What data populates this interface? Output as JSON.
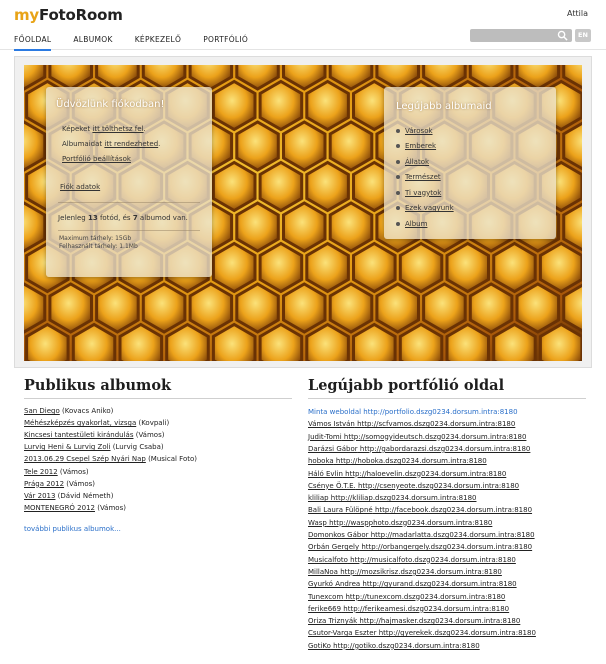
{
  "header": {
    "logo_my": "my",
    "logo_rest": "FotoRoom",
    "username": "Attila",
    "lang": "EN",
    "nav": [
      "FŐOLDAL",
      "ALBUMOK",
      "KÉPKEZELŐ",
      "PORTFÓLIÓ"
    ],
    "active_nav": "FŐOLDAL"
  },
  "welcome": {
    "title": "Üdvözlünk fiókodban!",
    "line1_pre": "Képeket ",
    "line1_link": "itt tölthetsz fel",
    "line1_post": ".",
    "line2_pre": "Albumaidat ",
    "line2_link": "itt rendezheted",
    "line2_post": ".",
    "line3_link": "Portfólió beállítások",
    "account_link": "Fiók adatok",
    "stats_pre": "Jelenleg ",
    "stats_photos": "13",
    "stats_mid": " fotód, és ",
    "stats_albums": "7",
    "stats_post": " albumod van.",
    "max_storage": "Maximum tárhely: 15Gb",
    "used_storage": "Felhasznált tárhely: 1.1Mb"
  },
  "latest_albums": {
    "title": "Legújabb albumaid",
    "items": [
      "Városok",
      "Emberek",
      "Állatok",
      "Természet",
      "Ti vagytok",
      "Ezek vagyunk",
      "Album"
    ]
  },
  "public_albums": {
    "title": "Publikus albumok",
    "items": [
      {
        "name": "San Diego",
        "owner": " (Kovacs Aniko)"
      },
      {
        "name": "Méhészképzés gyakorlat, vizsga",
        "owner": " (Kovpali)"
      },
      {
        "name": "Kincsesi tantestületi kirándulás",
        "owner": " (Vámos)"
      },
      {
        "name": "Lurvig Heni & Lurvig Zoli",
        "owner": " (Lurvig Csaba)"
      },
      {
        "name": "2013.06.29 Csepel Szép Nyári Nap",
        "owner": " (Musical Foto)"
      },
      {
        "name": "Tele 2012",
        "owner": " (Vámos)"
      },
      {
        "name": "Prága 2012",
        "owner": " (Vámos)"
      },
      {
        "name": "Vár 2013",
        "owner": " (Dávid Németh)"
      },
      {
        "name": "MONTENEGRÓ 2012",
        "owner": " (Vámos)"
      }
    ],
    "more": "további publikus albumok..."
  },
  "portfolio": {
    "title": "Legújabb portfólió oldal",
    "items": [
      {
        "name": "Minta weboldal",
        "url": " http://portfolio.dszg0234.dorsum.intra:8180",
        "highlight": true
      },
      {
        "name": "Vámos István",
        "url": " http://scfvamos.dszg0234.dorsum.intra:8180"
      },
      {
        "name": "Judit-Tomi",
        "url": " http://somogyideutsch.dszg0234.dorsum.intra:8180"
      },
      {
        "name": "Darázsi Gábor",
        "url": " http://gabordarazsi.dszg0234.dorsum.intra:8180"
      },
      {
        "name": "hoboka",
        "url": " http://hoboka.dszg0234.dorsum.intra:8180"
      },
      {
        "name": "Háló Evlin",
        "url": " http://haloevelin.dszg0234.dorsum.intra:8180"
      },
      {
        "name": "Csénye Ö.T.E.",
        "url": " http://csenyeote.dszg0234.dorsum.intra:8180"
      },
      {
        "name": "kliliap",
        "url": " http://kliliap.dszg0234.dorsum.intra:8180"
      },
      {
        "name": "Bali Laura Fülöpné",
        "url": " http://facebook.dszg0234.dorsum.intra:8180"
      },
      {
        "name": "Wasp",
        "url": " http://waspphoto.dszg0234.dorsum.intra:8180"
      },
      {
        "name": "Domonkos Gábor",
        "url": " http://madarlatta.dszg0234.dorsum.intra:8180"
      },
      {
        "name": "Orbán Gergely",
        "url": " http://orbangergely.dszg0234.dorsum.intra:8180"
      },
      {
        "name": "Musicalfoto",
        "url": " http://musicalfoto.dszg0234.dorsum.intra:8180"
      },
      {
        "name": "MillaNoa",
        "url": " http://mozsikrisz.dszg0234.dorsum.intra:8180"
      },
      {
        "name": "Gyurkó Andrea",
        "url": " http://gyurand.dszg0234.dorsum.intra:8180"
      },
      {
        "name": "Tunexcom",
        "url": " http://tunexcom.dszg0234.dorsum.intra:8180"
      },
      {
        "name": "ferike669",
        "url": " http://ferikeamesi.dszg0234.dorsum.intra:8180"
      },
      {
        "name": "Oriza Triznyák",
        "url": " http://hajmasker.dszg0234.dorsum.intra:8180"
      },
      {
        "name": "Csutor-Varga Eszter",
        "url": " http://gyerekek.dszg0234.dorsum.intra:8180"
      },
      {
        "name": "GotiKo",
        "url": " http://gotiko.dszg0234.dorsum.intra:8180"
      }
    ]
  },
  "colors": {
    "accent": "#e8a317",
    "link_blue": "#2a6fc9",
    "nav_underline": "#2a7ae2"
  }
}
